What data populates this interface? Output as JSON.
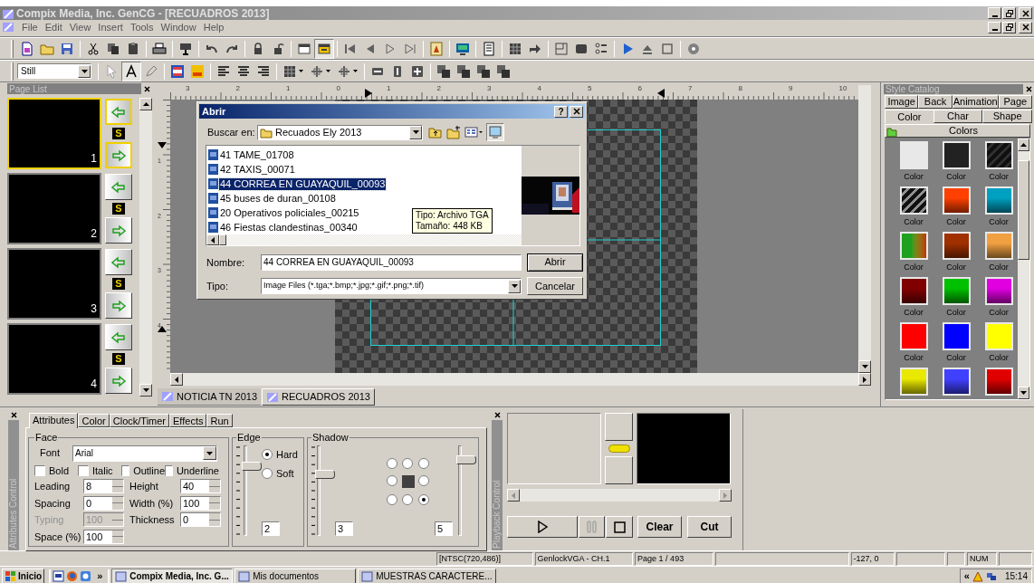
{
  "window": {
    "title": "Compix Media, Inc. GenCG - [RECUADROS 2013]"
  },
  "menu": [
    "File",
    "Edit",
    "View",
    "Insert",
    "Tools",
    "Window",
    "Help"
  ],
  "style_dropdown": {
    "value": "Still"
  },
  "page_list": {
    "title": "Page List",
    "pages": [
      {
        "number": "1",
        "badge": "S",
        "selected": true
      },
      {
        "number": "2",
        "badge": "S",
        "selected": false
      },
      {
        "number": "3",
        "badge": "S",
        "selected": false
      },
      {
        "number": "4",
        "badge": "S",
        "selected": false
      }
    ]
  },
  "ruler": {
    "horizontal": [
      "3",
      "2",
      "1",
      "0",
      "1",
      "2",
      "3",
      "4",
      "5",
      "6",
      "7",
      "8",
      "9",
      "10"
    ],
    "vertical": [
      "1",
      "2",
      "3",
      "4"
    ]
  },
  "documents": [
    {
      "label": "NOTICIA TN 2013",
      "selected": false
    },
    {
      "label": "RECUADROS 2013",
      "selected": true
    }
  ],
  "dialog": {
    "title": "Abrir",
    "help": "?",
    "look_in_label": "Buscar en:",
    "folder": "Recuados Ely 2013",
    "files": [
      {
        "name": "41 TAME_01708",
        "selected": false
      },
      {
        "name": "42 TAXIS_00071",
        "selected": false
      },
      {
        "name": "44 CORREA EN GUAYAQUIL_00093",
        "selected": true
      },
      {
        "name": "45 buses de duran_00108",
        "selected": false
      },
      {
        "name": "20 Operativos policiales_00215",
        "selected": false
      },
      {
        "name": "46 Fiestas clandestinas_00340",
        "selected": false
      }
    ],
    "tooltip": [
      "Tipo: Archivo TGA",
      "Tamaño: 448 KB"
    ],
    "name_label": "Nombre:",
    "name_value": "44 CORREA EN GUAYAQUIL_00093",
    "type_label": "Tipo:",
    "type_value": "Image Files (*.tga;*.bmp;*.jpg;*.gif;*.png;*.tif)",
    "buttons": [
      "Abrir",
      "Cancelar"
    ]
  },
  "style_catalog": {
    "title": "Style Catalog",
    "tab_rows": [
      [
        {
          "label": "Image",
          "selected": false
        },
        {
          "label": "Back",
          "selected": false
        },
        {
          "label": "Animation",
          "selected": false
        },
        {
          "label": "Page",
          "selected": false
        }
      ],
      [
        {
          "label": "Color",
          "selected": true
        },
        {
          "label": "Char",
          "selected": false
        },
        {
          "label": "Shape",
          "selected": false
        }
      ]
    ],
    "section": "Colors",
    "swatches": [
      {
        "kind": "solid",
        "color": "#e8e8e8",
        "label": "Color"
      },
      {
        "kind": "solid",
        "color": "#222222",
        "label": "Color"
      },
      {
        "kind": "striped",
        "color": "#303030",
        "label": "Color"
      },
      {
        "kind": "striped",
        "color": "#909090",
        "label": "Color"
      },
      {
        "kind": "gradient",
        "color": "#ff4000",
        "label": "Color"
      },
      {
        "kind": "gradient",
        "color": "#00a0c0",
        "label": "Color"
      },
      {
        "kind": "gradient_h",
        "color": "#20a020",
        "label": "Color"
      },
      {
        "kind": "gradient",
        "color": "#a03000",
        "label": "Color"
      },
      {
        "kind": "gradient",
        "color": "#f0a040",
        "label": "Color"
      },
      {
        "kind": "gradient",
        "color": "#800000",
        "label": "Color"
      },
      {
        "kind": "gradient",
        "color": "#00c000",
        "label": "Color"
      },
      {
        "kind": "gradient",
        "color": "#e000e0",
        "label": "Color"
      },
      {
        "kind": "solid",
        "color": "#ff0000",
        "label": "Color"
      },
      {
        "kind": "solid",
        "color": "#0000ff",
        "label": "Color"
      },
      {
        "kind": "solid",
        "color": "#ffff00",
        "label": "Color"
      },
      {
        "kind": "gradient",
        "color": "#e8e800"
      },
      {
        "kind": "gradient",
        "color": "#4040ff"
      },
      {
        "kind": "gradient",
        "color": "#e00000"
      }
    ]
  },
  "attributes": {
    "title": "Attributes Control",
    "tabs": [
      {
        "label": "Attributes",
        "selected": true
      },
      {
        "label": "Color",
        "selected": false
      },
      {
        "label": "Clock/Timer",
        "selected": false
      },
      {
        "label": "Effects",
        "selected": false
      },
      {
        "label": "Run",
        "selected": false
      }
    ],
    "face": {
      "title": "Face",
      "font_label": "Font",
      "font": "Arial",
      "checkboxes": [
        {
          "label": "Bold",
          "checked": false
        },
        {
          "label": "Italic",
          "checked": false
        },
        {
          "label": "Outline",
          "checked": false
        },
        {
          "label": "Underline",
          "checked": false
        }
      ],
      "fields": [
        {
          "label": "Leading",
          "value": "8",
          "disabled": false
        },
        {
          "label": "Height",
          "value": "40",
          "disabled": false
        },
        {
          "label": "Spacing",
          "value": "0",
          "disabled": false
        },
        {
          "label": "Width (%)",
          "value": "100",
          "disabled": false
        },
        {
          "label": "Typing",
          "value": "100",
          "disabled": true
        },
        {
          "label": "Thickness",
          "value": "0",
          "disabled": false
        },
        {
          "label": "Space (%)",
          "value": "100",
          "disabled": false
        }
      ]
    },
    "edge": {
      "title": "Edge",
      "slider": {
        "level": 0.8,
        "value": "2"
      },
      "options": [
        {
          "label": "Hard",
          "selected": true
        },
        {
          "label": "Soft",
          "selected": false
        }
      ]
    },
    "shadow": {
      "title": "Shadow",
      "sliders": [
        {
          "level": 0.7,
          "value": "3"
        },
        {
          "level": 0.87,
          "value": "5"
        }
      ],
      "directions": [
        {
          "kind": "radio",
          "selected": false
        },
        {
          "kind": "radio",
          "selected": false
        },
        {
          "kind": "radio",
          "selected": false
        },
        {
          "kind": "radio",
          "selected": false
        },
        {
          "kind": "center",
          "selected": false
        },
        {
          "kind": "radio",
          "selected": false
        },
        {
          "kind": "radio",
          "selected": false
        },
        {
          "kind": "radio",
          "selected": false
        },
        {
          "kind": "radio",
          "selected": true
        }
      ]
    }
  },
  "playback": {
    "title": "Playback Control",
    "buttons": [
      "Clear",
      "Cut"
    ]
  },
  "status_bar": {
    "format": "[NTSC(720,486)]",
    "genlock": "GenlockVGA - CH.1",
    "page": "Page 1 / 493",
    "position": "-127, 0",
    "num_lock": "NUM"
  },
  "taskbar": {
    "start": "Inicio",
    "more": "»",
    "tasks": [
      {
        "label": "Compix Media, Inc. G...",
        "selected": true
      },
      {
        "label": "Mis documentos",
        "selected": false
      },
      {
        "label": "MUESTRAS CARACTERE...",
        "selected": false
      }
    ],
    "tray_more": "«",
    "time": "15:14"
  }
}
